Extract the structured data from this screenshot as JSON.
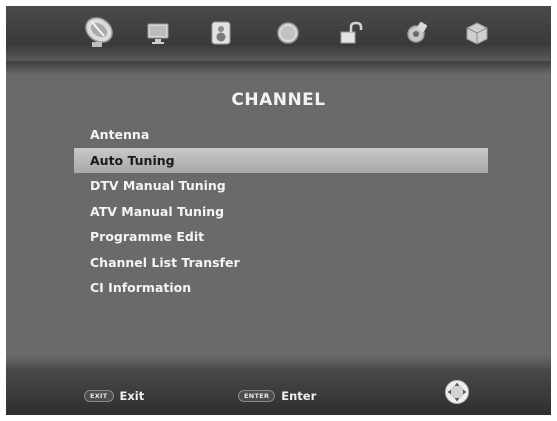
{
  "top_icons": [
    {
      "name": "satellite-dish-icon",
      "active": true
    },
    {
      "name": "monitor-icon",
      "active": false
    },
    {
      "name": "speaker-icon",
      "active": false
    },
    {
      "name": "clock-icon",
      "active": false
    },
    {
      "name": "lock-icon",
      "active": false
    },
    {
      "name": "settings-icon",
      "active": false
    },
    {
      "name": "cube-icon",
      "active": false
    }
  ],
  "menu": {
    "title": "CHANNEL",
    "items": [
      {
        "label": "Antenna",
        "selected": false
      },
      {
        "label": "Auto Tuning",
        "selected": true
      },
      {
        "label": "DTV Manual Tuning",
        "selected": false
      },
      {
        "label": "ATV Manual Tuning",
        "selected": false
      },
      {
        "label": "Programme Edit",
        "selected": false
      },
      {
        "label": "Channel List Transfer",
        "selected": false
      },
      {
        "label": "CI Information",
        "selected": false
      }
    ]
  },
  "footer": {
    "exit_key": "EXIT",
    "exit_label": "Exit",
    "enter_key": "ENTER",
    "enter_label": "Enter",
    "nav_icon": "direction-pad-icon"
  }
}
